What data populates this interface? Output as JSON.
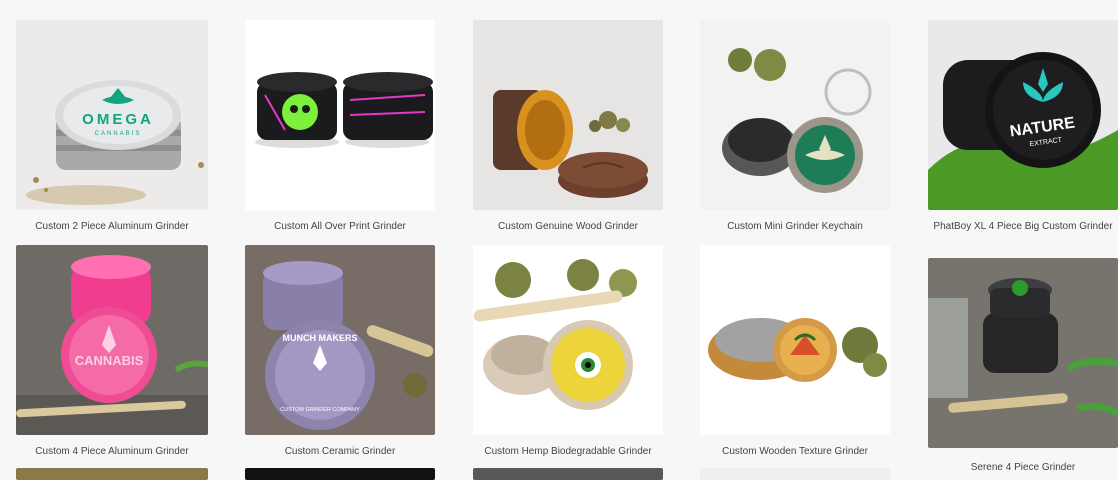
{
  "products": [
    {
      "name": "Custom 2 Piece Aluminum Grinder",
      "image_text": [
        "OMEGA",
        "CANNABIS"
      ]
    },
    {
      "name": "Custom All Over Print Grinder",
      "image_text": []
    },
    {
      "name": "Custom Genuine Wood Grinder",
      "image_text": []
    },
    {
      "name": "Custom Mini Grinder Keychain",
      "image_text": []
    },
    {
      "name": "PhatBoy XL 4 Piece Big Custom Grinder",
      "image_text": [
        "NATURE",
        "EXTRACT"
      ]
    },
    {
      "name": "Custom 4 Piece Aluminum Grinder",
      "image_text": [
        "CANNABIS"
      ]
    },
    {
      "name": "Custom Ceramic Grinder",
      "image_text": [
        "MUNCH MAKERS",
        "CUSTOM GRINDER COMPANY"
      ]
    },
    {
      "name": "Custom Hemp Biodegradable Grinder",
      "image_text": []
    },
    {
      "name": "Custom Wooden Texture Grinder",
      "image_text": []
    },
    {
      "name": "Serene 4 Piece Grinder",
      "image_text": []
    }
  ]
}
